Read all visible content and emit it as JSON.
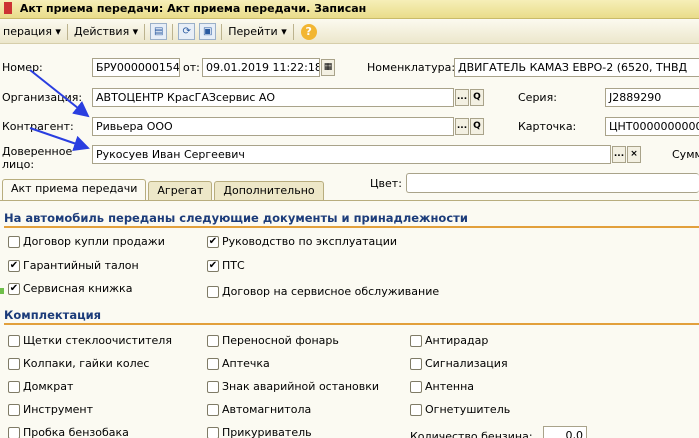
{
  "window": {
    "title": "Акт приема передачи: Акт приема передачи. Записан"
  },
  "toolbar": {
    "operation": "перация ▾",
    "actions": "Действия ▾",
    "goto": "Перейти ▾",
    "help": "?"
  },
  "form": {
    "number_label": "Номер:",
    "number_value": "БРУ000000154",
    "from_label": "от:",
    "date_value": "09.01.2019 11:22:18",
    "nomenclature_label": "Номенклатура:",
    "nomenclature_value": "ДВИГАТЕЛЬ КАМАЗ ЕВРО-2 (6520, ТНВД",
    "organization_label": "Организация:",
    "organization_value": "АВТОЦЕНТР КрасГАЗсервис АО",
    "series_label": "Серия:",
    "series_value": "J2889290",
    "counterparty_label": "Контрагент:",
    "counterparty_value": "Ривьера ООО",
    "card_label": "Карточка:",
    "card_value": "ЦНТ0000000000",
    "trusted_label_1": "Доверенное",
    "trusted_label_2": "лицо:",
    "trusted_value": "Рукосуев Иван Сергеевич",
    "sum_label": "Сумм",
    "color_label": "Цвет:",
    "ellipsis": "...",
    "search": "Q",
    "clear": "×",
    "calendar": "▦"
  },
  "tabs": [
    "Акт приема передачи",
    "Агрегат",
    "Дополнительно"
  ],
  "docs_section": {
    "title": "На автомобиль переданы следующие документы и принадлежности",
    "items": [
      {
        "label": "Договор купли продажи",
        "checked": false
      },
      {
        "label": "Руководство по эксплуатации",
        "checked": true
      },
      {
        "label": "Гарантийный талон",
        "checked": true
      },
      {
        "label": "ПТС",
        "checked": true
      },
      {
        "label": "Сервисная книжка",
        "checked": true
      },
      {
        "label": "Договор на сервисное обслуживание",
        "checked": false
      }
    ]
  },
  "kit_section": {
    "title": "Комплектация",
    "items": [
      {
        "label": "Щетки стеклоочистителя",
        "checked": false
      },
      {
        "label": "Переносной фонарь",
        "checked": false
      },
      {
        "label": "Антирадар",
        "checked": false
      },
      {
        "label": "Колпаки, гайки колес",
        "checked": false
      },
      {
        "label": "Аптечка",
        "checked": false
      },
      {
        "label": "Сигнализация",
        "checked": false
      },
      {
        "label": "Домкрат",
        "checked": false
      },
      {
        "label": "Знак аварийной остановки",
        "checked": false
      },
      {
        "label": "Антенна",
        "checked": false
      },
      {
        "label": "Инструмент",
        "checked": false
      },
      {
        "label": "Автомагнитола",
        "checked": false
      },
      {
        "label": "Огнетушитель",
        "checked": false
      },
      {
        "label": "Пробка бензобака",
        "checked": false
      },
      {
        "label": "Прикуриватель",
        "checked": false
      }
    ],
    "fuel_label": "Количество бензина:",
    "fuel_value": "0,0"
  },
  "colors": {
    "section_title": "#1c3c7a",
    "section_line": "#e2a03c",
    "arrow": "#2a3ee0"
  }
}
